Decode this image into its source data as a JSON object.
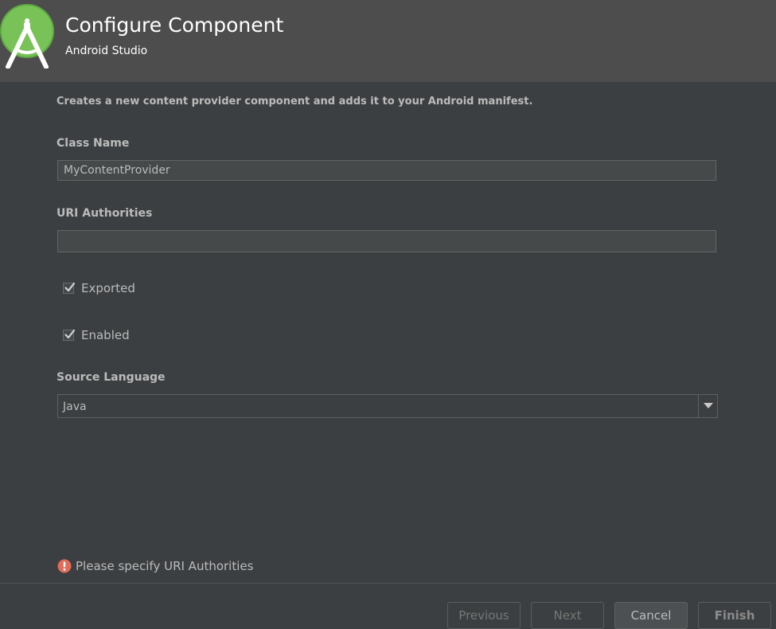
{
  "header": {
    "title": "Configure Component",
    "subtitle": "Android Studio"
  },
  "description": "Creates a new content provider component and adds it to your Android manifest.",
  "form": {
    "class_name": {
      "label": "Class Name",
      "value": "MyContentProvider"
    },
    "uri_authorities": {
      "label": "URI Authorities",
      "value": ""
    },
    "exported": {
      "label": "Exported",
      "checked": true
    },
    "enabled": {
      "label": "Enabled",
      "checked": true
    },
    "source_language": {
      "label": "Source Language",
      "value": "Java"
    }
  },
  "validation": {
    "message": "Please specify URI Authorities",
    "color": "#e06c5a"
  },
  "buttons": {
    "previous": "Previous",
    "next": "Next",
    "cancel": "Cancel",
    "finish": "Finish"
  },
  "icons": {
    "logo": "android-studio-logo",
    "checkbox": "check-icon",
    "dropdown": "chevron-down-icon",
    "error": "error-icon"
  },
  "colors": {
    "logo_green": "#78c257",
    "background": "#3c3f41",
    "header": "#4d4d4d"
  }
}
